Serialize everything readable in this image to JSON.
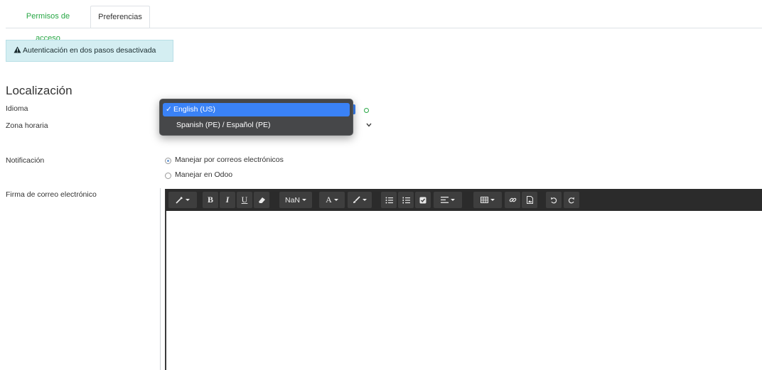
{
  "tabs": [
    {
      "label": "Permisos de acceso",
      "color": "#28a745"
    },
    {
      "label": "Preferencias",
      "active": true
    }
  ],
  "alert": {
    "text": "Autenticación en dos pasos desactivada",
    "icon": "warning-icon"
  },
  "localization": {
    "title": "Localización",
    "language_label": "Idioma",
    "timezone_label": "Zona horaria",
    "language_options": [
      {
        "label": "English (US)",
        "selected": true
      },
      {
        "label": "Spanish (PE) / Español (PE)",
        "selected": false
      }
    ]
  },
  "notification": {
    "label": "Notificación",
    "options": [
      {
        "label": "Manejar por correos electrónicos",
        "selected": true
      },
      {
        "label": "Manejar en Odoo",
        "selected": false
      }
    ]
  },
  "signature": {
    "label": "Firma de correo electrónico",
    "toolbar": {
      "font_size": "NaN",
      "bold": "B",
      "italic": "I",
      "underline": "U",
      "font_color": "A"
    }
  },
  "colors": {
    "accent": "#3a82f7",
    "success": "#28a745",
    "alert_bg": "#d4eef2",
    "toolbar_bg": "#2b2b2b"
  }
}
